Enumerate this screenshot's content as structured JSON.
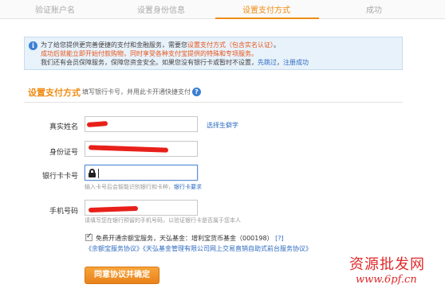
{
  "steps": {
    "step1": "验证账户名",
    "step2": "设置身份信息",
    "step3": "设置支付方式",
    "step4": "成功"
  },
  "notice": {
    "line1_prefix": "为了给您提供更完善便捷的支付和金融服务，需要您",
    "line1_link": "设置支付方式（包含实名认证）",
    "line1_suffix": "。",
    "line2": "成功后就能立即开始付款购物，同时享受各种支付宝提供的特殊和专项服务。",
    "line3_prefix": "我们还有会员保障服务，保障您资金安全。如果您没有银行卡或暂时不设置，",
    "line3_link1": "先跳过",
    "line3_sep": "，",
    "line3_link2": "注册成功"
  },
  "section": {
    "title": "设置支付方式",
    "subtitle": "填写银行卡号，并用此卡开通快捷支付"
  },
  "form": {
    "real_name_label": "真实姓名",
    "rare_char_link": "选择生僻字",
    "id_label": "身份证号",
    "card_label": "银行卡卡号",
    "card_hint_prefix": "输入卡号后会智能识别银行和卡种，",
    "card_hint_link": "银行卡要求",
    "phone_label": "手机号码",
    "phone_hint": "请填写您在银行预留的手机号码，以验证银行卡是否属于您本人"
  },
  "agreement": {
    "text": "免费开通余额宝服务，天弘基金：增利宝货币基金（000198）",
    "help": "[?]",
    "links": "《余额宝服务协议》《天弘基金管理有限公司网上交易直销自助式前台服务协议》"
  },
  "submit_label": "同意协议并确定",
  "watermark": {
    "line1": "资源批发网",
    "line2": "www.6pf.cn"
  },
  "colors": {
    "accent": "#f08c14",
    "link": "#2d6bc0",
    "redaction": "#e8201a"
  }
}
